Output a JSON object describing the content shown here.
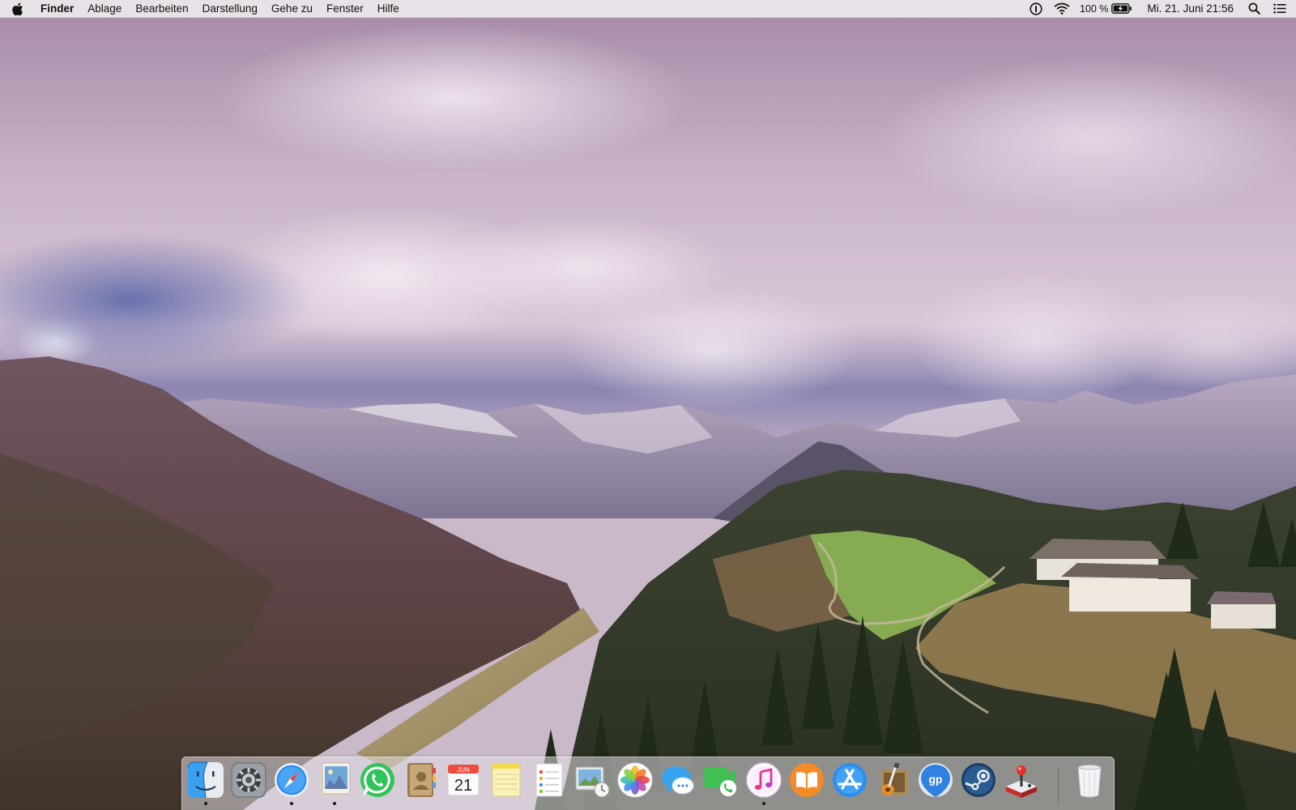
{
  "menubar": {
    "app_name": "Finder",
    "items": [
      "Ablage",
      "Bearbeiten",
      "Darstellung",
      "Gehe zu",
      "Fenster",
      "Hilfe"
    ],
    "status": {
      "battery_percent": "100 %",
      "datetime": "Mi. 21. Juni  21:56",
      "icons": [
        "onepassword-icon",
        "wifi-icon",
        "battery-charging-icon",
        "spotlight-search-icon",
        "notification-center-icon"
      ]
    }
  },
  "dock": {
    "apps": [
      {
        "icon": "finder-icon",
        "running": true
      },
      {
        "icon": "system-preferences-icon",
        "running": false
      },
      {
        "icon": "safari-icon",
        "running": true
      },
      {
        "icon": "preview-icon",
        "running": true
      },
      {
        "icon": "whatsapp-icon",
        "running": false
      },
      {
        "icon": "contacts-icon",
        "running": false
      },
      {
        "icon": "calendar-icon",
        "running": false,
        "month": "JUN",
        "day": "21"
      },
      {
        "icon": "notes-icon",
        "running": false
      },
      {
        "icon": "reminders-icon",
        "running": false
      },
      {
        "icon": "photo-slideshow-icon",
        "running": false
      },
      {
        "icon": "photos-icon",
        "running": false
      },
      {
        "icon": "messages-icon",
        "running": false
      },
      {
        "icon": "facetime-icon",
        "running": false
      },
      {
        "icon": "itunes-icon",
        "running": true
      },
      {
        "icon": "ibooks-icon",
        "running": false
      },
      {
        "icon": "app-store-icon",
        "running": false
      },
      {
        "icon": "garageband-icon",
        "running": false
      },
      {
        "icon": "guitar-pro-icon",
        "running": false
      },
      {
        "icon": "steam-icon",
        "running": false
      },
      {
        "icon": "arcade-joystick-icon",
        "running": false
      }
    ],
    "trash": {
      "icon": "trash-icon"
    }
  },
  "colors": {
    "menubar_bg": "#ece8ec",
    "sky_purple": "#a489a6",
    "forest_dark": "#2f3a22",
    "meadow_green": "#8fb857"
  }
}
